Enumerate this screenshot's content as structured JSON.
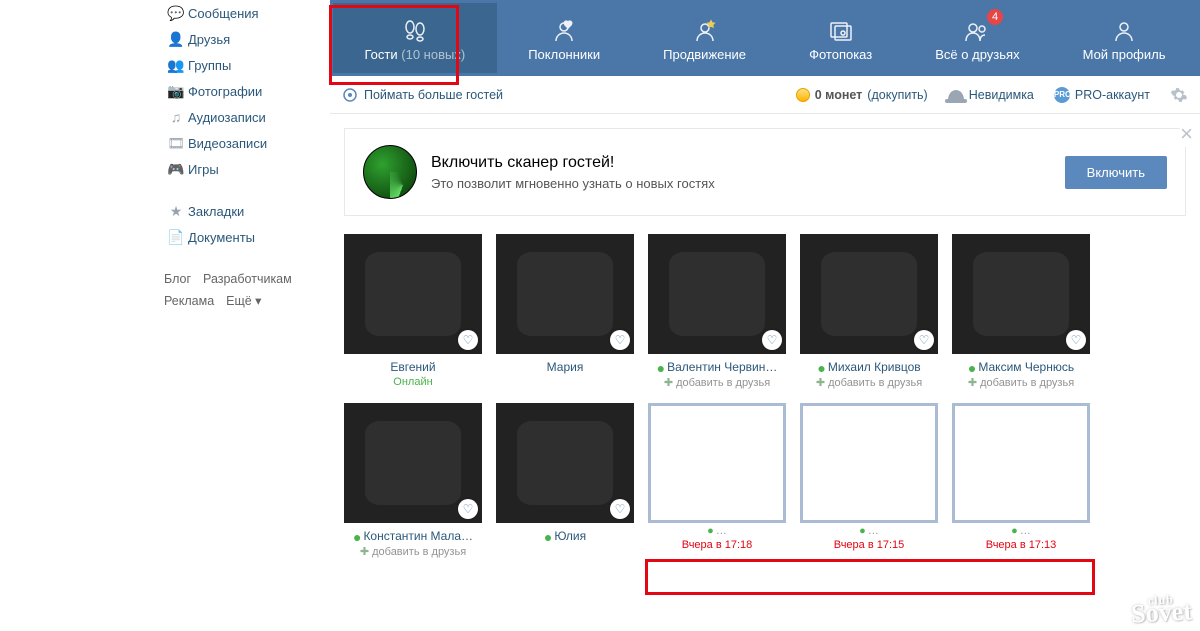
{
  "sidebar": {
    "items": [
      {
        "icon": "💬",
        "label": "Сообщения"
      },
      {
        "icon": "👤",
        "label": "Друзья"
      },
      {
        "icon": "👥",
        "label": "Группы"
      },
      {
        "icon": "📷",
        "label": "Фотографии"
      },
      {
        "icon": "♫",
        "label": "Аудиозаписи"
      },
      {
        "icon": "🎞",
        "label": "Видеозаписи"
      },
      {
        "icon": "🎮",
        "label": "Игры"
      },
      {
        "icon": "★",
        "label": "Закладки"
      },
      {
        "icon": "📄",
        "label": "Документы"
      }
    ],
    "extras": [
      "Блог",
      "Разработчикам",
      "Реклама",
      "Ещё ▾"
    ]
  },
  "tabs": [
    {
      "label": "Гости",
      "sub": "(10 новых)",
      "icon": "footprints"
    },
    {
      "label": "Поклонники",
      "icon": "heart-person"
    },
    {
      "label": "Продвижение",
      "icon": "star-person"
    },
    {
      "label": "Фотопоказ",
      "icon": "photos"
    },
    {
      "label": "Всё о друзьях",
      "icon": "friends",
      "badge": "4"
    },
    {
      "label": "Мой профиль",
      "icon": "profile"
    }
  ],
  "subbar": {
    "catch_more": "Поймать больше гостей",
    "coins_count": "0 монет",
    "coins_buy": "(докупить)",
    "invisible": "Невидимка",
    "pro": "PRO-аккаунт"
  },
  "banner": {
    "title": "Включить сканер гостей!",
    "subtitle": "Это позволит мгновенно узнать о новых гостях",
    "button": "Включить"
  },
  "add_friend_label": "добавить в друзья",
  "guests_row1": [
    {
      "name": "Евгений",
      "status": "Онлайн",
      "online": false,
      "addfriend": false,
      "photo": "ph1"
    },
    {
      "name": "Мария",
      "status": "",
      "online": false,
      "addfriend": false,
      "photo": "ph2"
    },
    {
      "name": "Валентин Червин…",
      "online": true,
      "addfriend": true,
      "photo": "ph3"
    },
    {
      "name": "Михаил Кривцов",
      "online": true,
      "addfriend": true,
      "photo": "ph4"
    },
    {
      "name": "Максим Чернюсь",
      "online": true,
      "addfriend": true,
      "photo": "ph5"
    }
  ],
  "guests_row2": [
    {
      "name": "Константин Мала…",
      "online": true,
      "addfriend": true,
      "photo": "ph6"
    },
    {
      "name": "Юлия",
      "online": true,
      "addfriend": false,
      "photo": "ph7"
    },
    {
      "empty": true,
      "hidden_name": "…",
      "time": "Вчера в 17:18"
    },
    {
      "empty": true,
      "hidden_name": "…",
      "time": "Вчера в 17:15"
    },
    {
      "empty": true,
      "hidden_name": "…",
      "time": "Вчера в 17:13"
    }
  ],
  "watermark": {
    "top": "club",
    "bottom": "Sovet"
  }
}
